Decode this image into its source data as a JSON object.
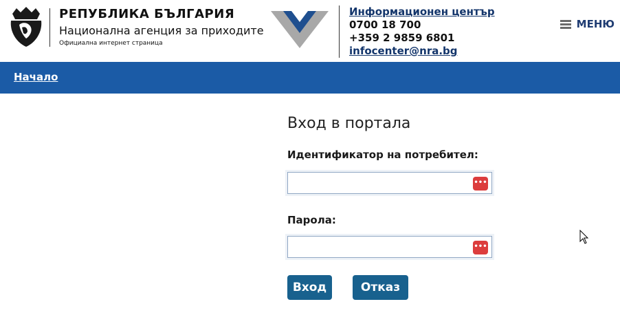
{
  "header": {
    "country": "РЕПУБЛИКА БЪЛГАРИЯ",
    "agency": "Национална агенция за приходите",
    "official": "Официална интернет страница",
    "info_title": "Информационен център",
    "phone1": "0700 18 700",
    "phone2": "+359 2 9859 6801",
    "email": "infocenter@nra.bg",
    "menu_label": "МЕНЮ"
  },
  "nav": {
    "home": "Начало"
  },
  "login": {
    "title": "Вход в портала",
    "user_label": "Идентификатор на потребител:",
    "user_value": "",
    "password_label": "Парола:",
    "password_value": "",
    "password_manager_icon": "•••",
    "login_button": "Вход",
    "cancel_button": "Отказ"
  },
  "colors": {
    "navbar": "#1b5ba6",
    "button": "#18618e",
    "link": "#13356b",
    "pw_icon": "#dc3d3d"
  }
}
